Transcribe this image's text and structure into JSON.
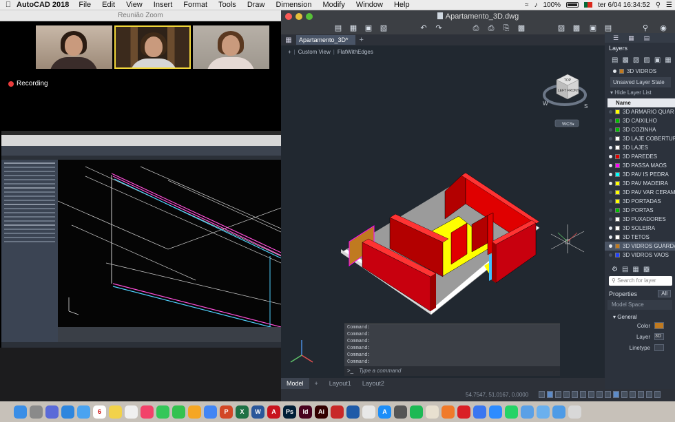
{
  "menubar": {
    "app_name": "AutoCAD 2018",
    "menus": [
      "File",
      "Edit",
      "View",
      "Insert",
      "Format",
      "Tools",
      "Draw",
      "Dimension",
      "Modify",
      "Window",
      "Help"
    ],
    "battery": "100%",
    "datetime": "ter 6/04  16:34:52",
    "icons": [
      "wifi-icon",
      "volume-icon",
      "battery-icon",
      "flag-icon",
      "search-icon",
      "control-center-icon"
    ]
  },
  "zoom": {
    "title": "Reunião Zoom",
    "recording_label": "Recording",
    "participants": [
      "participant-1",
      "participant-2",
      "participant-3"
    ]
  },
  "acad": {
    "doc_title": "Apartamento_3D.dwg",
    "tab_label": "Apartamento_3D*",
    "view_controls": [
      "Custom View",
      "FlatWithEdges"
    ],
    "viewcube": {
      "top": "TOP",
      "left": "LEFT",
      "front": "FRONT",
      "compass_w": "W",
      "compass_s": "S",
      "wcs": "WCS"
    },
    "command_lines": [
      "Command:",
      "Command:",
      "Command:",
      "Command:",
      "Command:",
      "Command:"
    ],
    "command_placeholder": "Type a command",
    "layout_tabs": [
      "Model",
      "Layout1",
      "Layout2"
    ],
    "coordinates": "54.7547, 51.0167, 0.0000",
    "colors": {
      "wall": "#c8000e",
      "floor": "#ffff00",
      "edge": "#ff00ff"
    }
  },
  "palette": {
    "layers_title": "Layers",
    "current_layer": "3D VIDROS",
    "layer_state": "Unsaved Layer State",
    "hide_list": "Hide Layer List",
    "name_header": "Name",
    "layers": [
      {
        "name": "3D ARMARIO QUAR",
        "on": false,
        "color": "#ffff00"
      },
      {
        "name": "3D CAIXILHO",
        "on": false,
        "color": "#00c000"
      },
      {
        "name": "3D COZINHA",
        "on": false,
        "color": "#00c000"
      },
      {
        "name": "3D LAJE COBERTUR",
        "on": false,
        "color": "#ffffff"
      },
      {
        "name": "3D LAJES",
        "on": true,
        "color": "#ffffff"
      },
      {
        "name": "3D PAREDES",
        "on": true,
        "color": "#e00000"
      },
      {
        "name": "3D PASSA MAOS",
        "on": true,
        "color": "#ff00ff"
      },
      {
        "name": "3D PAV IS PEDRA",
        "on": true,
        "color": "#00ffff"
      },
      {
        "name": "3D PAV MADEIRA",
        "on": true,
        "color": "#ffff00"
      },
      {
        "name": "3D PAV VAR CERAM",
        "on": false,
        "color": "#ffff00"
      },
      {
        "name": "3D PORTADAS",
        "on": false,
        "color": "#ffff00"
      },
      {
        "name": "3D PORTAS",
        "on": false,
        "color": "#00c000"
      },
      {
        "name": "3D PUXADORES",
        "on": false,
        "color": "#ffffff"
      },
      {
        "name": "3D SOLEIRA",
        "on": true,
        "color": "#ffffff"
      },
      {
        "name": "3D TETOS",
        "on": true,
        "color": "#ffffff"
      },
      {
        "name": "3D VIDROS GUARDA",
        "on": true,
        "color": "#c07a20"
      },
      {
        "name": "3D VIDROS VAOS",
        "on": false,
        "color": "#2040ff"
      }
    ],
    "search_placeholder": "Search for layer",
    "properties_title": "Properties",
    "filter_all": "All",
    "model_space": "Model Space",
    "general": "General",
    "prop_rows": [
      {
        "label": "Color",
        "value": ""
      },
      {
        "label": "Layer",
        "value": "3D"
      },
      {
        "label": "Linetype",
        "value": ""
      }
    ]
  },
  "dock": {
    "apps": [
      {
        "name": "finder",
        "color": "#3a8ee6",
        "label": ""
      },
      {
        "name": "system-preferences",
        "color": "#8a8a8a",
        "label": ""
      },
      {
        "name": "launchpad",
        "color": "#5a6ad8",
        "label": ""
      },
      {
        "name": "safari",
        "color": "#2e86de",
        "label": ""
      },
      {
        "name": "mail",
        "color": "#4aa3f0",
        "label": ""
      },
      {
        "name": "calendar",
        "color": "#ffffff",
        "label": "6"
      },
      {
        "name": "notes",
        "color": "#f2d24a",
        "label": ""
      },
      {
        "name": "reminders",
        "color": "#f0f0f0",
        "label": ""
      },
      {
        "name": "music",
        "color": "#f2426a",
        "label": ""
      },
      {
        "name": "messages",
        "color": "#35c759",
        "label": ""
      },
      {
        "name": "facetime",
        "color": "#34c24f",
        "label": ""
      },
      {
        "name": "photos",
        "color": "#f5a623",
        "label": ""
      },
      {
        "name": "chrome",
        "color": "#4285f4",
        "label": ""
      },
      {
        "name": "powerpoint",
        "color": "#d24726",
        "label": "P"
      },
      {
        "name": "excel",
        "color": "#1e7145",
        "label": "X"
      },
      {
        "name": "word",
        "color": "#2b579a",
        "label": "W"
      },
      {
        "name": "autocad",
        "color": "#c8141e",
        "label": "A"
      },
      {
        "name": "photoshop",
        "color": "#001e36",
        "label": "Ps"
      },
      {
        "name": "indesign",
        "color": "#49021f",
        "label": "Id"
      },
      {
        "name": "illustrator",
        "color": "#330000",
        "label": "Ai"
      },
      {
        "name": "sketchup",
        "color": "#c82828",
        "label": ""
      },
      {
        "name": "archicad",
        "color": "#1e5aa8",
        "label": ""
      },
      {
        "name": "preview",
        "color": "#e8e8e8",
        "label": ""
      },
      {
        "name": "app-store",
        "color": "#1c8ef9",
        "label": "A"
      },
      {
        "name": "final-cut",
        "color": "#555555",
        "label": ""
      },
      {
        "name": "spotify",
        "color": "#1db954",
        "label": ""
      },
      {
        "name": "popcorn",
        "color": "#e8e0d0",
        "label": ""
      },
      {
        "name": "vpn",
        "color": "#f07a2a",
        "label": ""
      },
      {
        "name": "adobe-cc",
        "color": "#da1f26",
        "label": ""
      },
      {
        "name": "signal",
        "color": "#3a76f0",
        "label": ""
      },
      {
        "name": "zoom",
        "color": "#2d8cff",
        "label": ""
      },
      {
        "name": "whatsapp",
        "color": "#25d366",
        "label": ""
      },
      {
        "name": "downloads",
        "color": "#5aa0e6",
        "label": ""
      },
      {
        "name": "documents",
        "color": "#6ab0ee",
        "label": ""
      },
      {
        "name": "folder",
        "color": "#4e9be6",
        "label": ""
      },
      {
        "name": "trash",
        "color": "#d8d8d8",
        "label": ""
      }
    ]
  }
}
